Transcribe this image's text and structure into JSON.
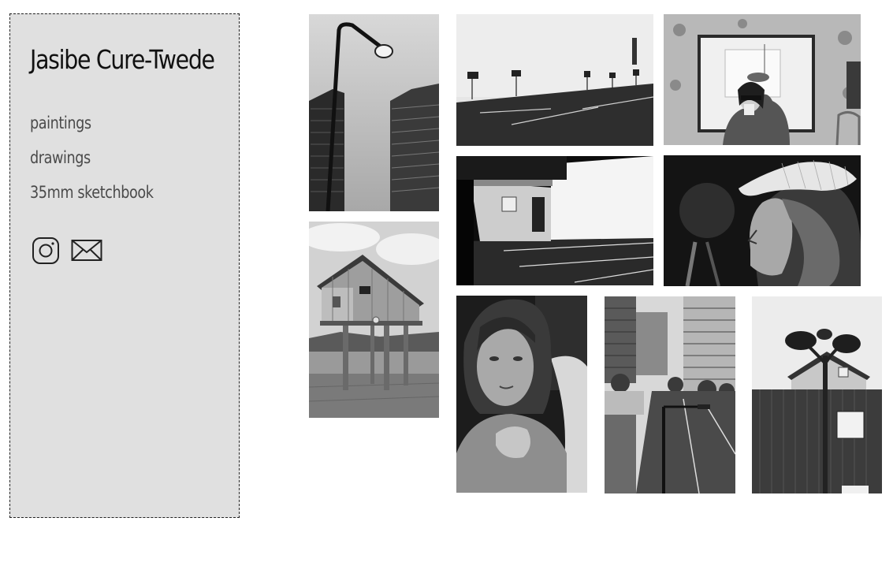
{
  "site": {
    "title": "Jasibe Cure-Twede"
  },
  "nav": {
    "items": [
      {
        "label": "paintings"
      },
      {
        "label": "drawings"
      },
      {
        "label": "35mm sketchbook"
      }
    ]
  },
  "social": {
    "icons": [
      "instagram-icon",
      "email-icon"
    ]
  },
  "gallery": {
    "photos": [
      {
        "subject": "street lamp between high-rise towers"
      },
      {
        "subject": "empty parking lot with white wall"
      },
      {
        "subject": "mirror self-portrait with cup"
      },
      {
        "subject": "stilt house sculpture by the water"
      },
      {
        "subject": "small shed beside parking lot"
      },
      {
        "subject": "man in mesh cap looking down"
      },
      {
        "subject": "portrait of older woman"
      },
      {
        "subject": "city street with towers and lamp post"
      },
      {
        "subject": "double street lamp in front of building"
      }
    ]
  }
}
